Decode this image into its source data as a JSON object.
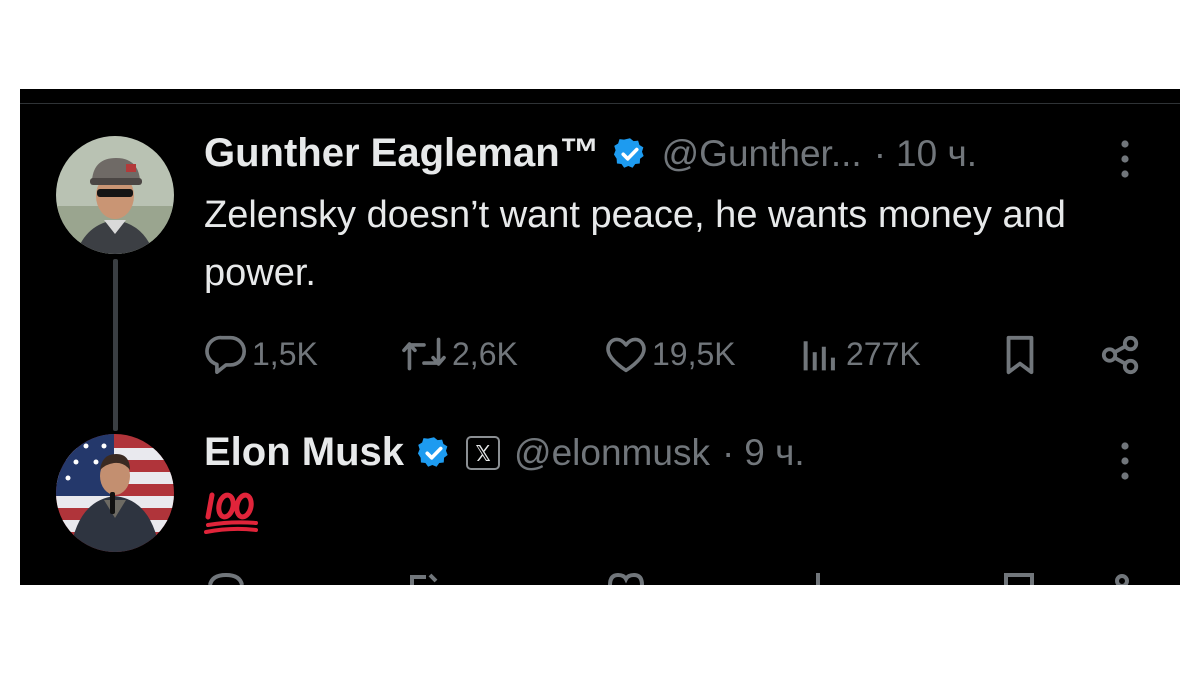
{
  "tweets": [
    {
      "author": "Gunther Eagleman™",
      "handle": "@Gunther...",
      "time": "10 ч.",
      "text": "Zelensky doesn’t want peace, he wants money and power.",
      "actions": {
        "replies": "1,5K",
        "reposts": "2,6K",
        "likes": "19,5K",
        "views": "277K"
      }
    },
    {
      "author": "Elon Musk",
      "handle": "@elonmusk",
      "time": "9 ч.",
      "text": "💯"
    }
  ],
  "separator": "·",
  "colors": {
    "background": "#000000",
    "text": "#e7e9ea",
    "secondary": "#71767b",
    "verified": "#1d9bf0"
  }
}
